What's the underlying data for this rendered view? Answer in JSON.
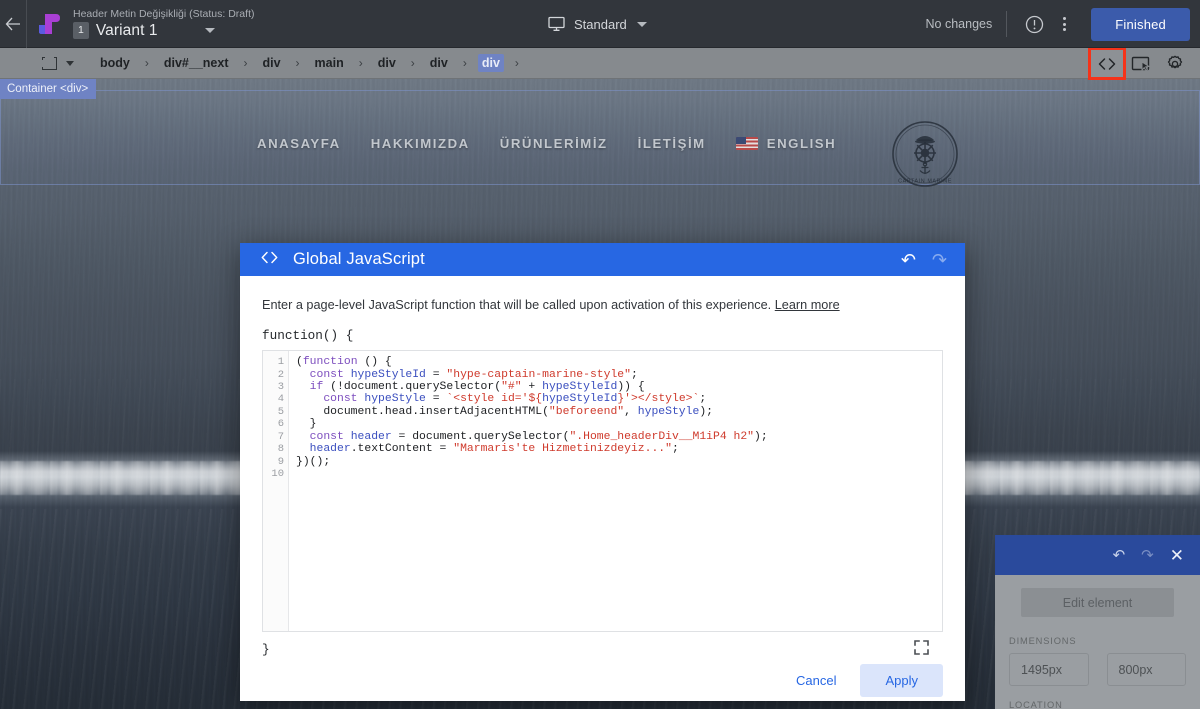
{
  "topbar": {
    "back_icon": "arrow-left-icon",
    "brand_icon": "optimizely-logo-icon",
    "experiment_name": "Header Metin Değişikliği (Status: Draft)",
    "variant_number": "1",
    "variant_label": "Variant 1",
    "device_icon": "monitor-icon",
    "device_label": "Standard",
    "changes_status": "No changes",
    "alert_icon": "exclamation-circle-icon",
    "menu_icon": "kebab-menu-icon",
    "finished_label": "Finished"
  },
  "breadcrumb": {
    "select_icon": "element-select-icon",
    "items": [
      {
        "label": "body",
        "active": false
      },
      {
        "label": "div#__next",
        "active": false
      },
      {
        "label": "div",
        "active": false
      },
      {
        "label": "main",
        "active": false
      },
      {
        "label": "div",
        "active": false
      },
      {
        "label": "div",
        "active": false
      },
      {
        "label": "div",
        "active": true
      }
    ],
    "separator": "›",
    "tools": [
      {
        "icon": "code-brackets-icon",
        "label": "<>",
        "highlighted": true,
        "highlight_color": "#f5331a"
      },
      {
        "icon": "screen-cursor-icon",
        "label": "",
        "highlighted": false
      },
      {
        "icon": "gear-icon",
        "label": "",
        "highlighted": false
      }
    ]
  },
  "canvas": {
    "selection_tooltip": "Container <div>",
    "site_nav": {
      "links": [
        "ANASAYFA",
        "HAKKIMIZDA",
        "ÜRÜNLERİMİZ",
        "İLETİŞİM"
      ],
      "language": {
        "flag_icon": "us-flag-icon",
        "label": "ENGLISH"
      },
      "logo": {
        "icon": "captain-marine-logo-icon",
        "text_top": "CAPTAIN",
        "text_bottom": "MARINE"
      }
    }
  },
  "dialog": {
    "icon": "code-brackets-icon",
    "title": "Global JavaScript",
    "undo_icon": "undo-icon",
    "redo_icon": "redo-icon",
    "description": "Enter a page-level JavaScript function that will be called upon activation of this experience.",
    "learn_more": "Learn more",
    "function_open": "function() {",
    "function_close": "}",
    "expand_icon": "fullscreen-expand-icon",
    "line_numbers": [
      "1",
      "2",
      "3",
      "4",
      "5",
      "6",
      "7",
      "8",
      "9",
      "10"
    ],
    "code_lines": [
      [
        {
          "t": "(",
          "c": "pl"
        },
        {
          "t": "function",
          "c": "kw"
        },
        {
          "t": " () {",
          "c": "pl"
        }
      ],
      [
        {
          "t": "  ",
          "c": "pl"
        },
        {
          "t": "const",
          "c": "kw"
        },
        {
          "t": " ",
          "c": "pl"
        },
        {
          "t": "hypeStyleId",
          "c": "id"
        },
        {
          "t": " = ",
          "c": "pl"
        },
        {
          "t": "\"hype-captain-marine-style\"",
          "c": "str"
        },
        {
          "t": ";",
          "c": "pl"
        }
      ],
      [
        {
          "t": "  ",
          "c": "pl"
        },
        {
          "t": "if",
          "c": "kw"
        },
        {
          "t": " (!document.querySelector(",
          "c": "pl"
        },
        {
          "t": "\"#\"",
          "c": "str"
        },
        {
          "t": " + ",
          "c": "pl"
        },
        {
          "t": "hypeStyleId",
          "c": "id"
        },
        {
          "t": ")) {",
          "c": "pl"
        }
      ],
      [
        {
          "t": "    ",
          "c": "pl"
        },
        {
          "t": "const",
          "c": "kw"
        },
        {
          "t": " ",
          "c": "pl"
        },
        {
          "t": "hypeStyle",
          "c": "id"
        },
        {
          "t": " = ",
          "c": "pl"
        },
        {
          "t": "`<style id='${",
          "c": "str"
        },
        {
          "t": "hypeStyleId",
          "c": "id"
        },
        {
          "t": "}'></style>`",
          "c": "str"
        },
        {
          "t": ";",
          "c": "pl"
        }
      ],
      [
        {
          "t": "    document.head.insertAdjacentHTML(",
          "c": "pl"
        },
        {
          "t": "\"beforeend\"",
          "c": "str"
        },
        {
          "t": ", ",
          "c": "pl"
        },
        {
          "t": "hypeStyle",
          "c": "id"
        },
        {
          "t": ");",
          "c": "pl"
        }
      ],
      [
        {
          "t": "  }",
          "c": "pl"
        }
      ],
      [
        {
          "t": "  ",
          "c": "pl"
        },
        {
          "t": "const",
          "c": "kw"
        },
        {
          "t": " ",
          "c": "pl"
        },
        {
          "t": "header",
          "c": "id"
        },
        {
          "t": " = document.querySelector(",
          "c": "pl"
        },
        {
          "t": "\".Home_headerDiv__M1iP4 h2\"",
          "c": "str"
        },
        {
          "t": ");",
          "c": "pl"
        }
      ],
      [
        {
          "t": "  ",
          "c": "pl"
        },
        {
          "t": "header",
          "c": "id"
        },
        {
          "t": ".textContent = ",
          "c": "pl"
        },
        {
          "t": "\"Marmaris'te Hizmetinizdeyiz...\"",
          "c": "str"
        },
        {
          "t": ";",
          "c": "pl"
        }
      ],
      [
        {
          "t": "})();",
          "c": "pl"
        }
      ],
      [
        {
          "t": "",
          "c": "pl"
        }
      ]
    ],
    "cancel_label": "Cancel",
    "apply_label": "Apply",
    "header_color": "#2767e3"
  },
  "side_panel": {
    "undo_icon": "undo-icon",
    "redo_icon": "redo-icon",
    "close_icon": "close-icon",
    "edit_element_label": "Edit element",
    "dimensions_label": "DIMENSIONS",
    "width_value": "1495px",
    "height_value": "800px",
    "location_label": "LOCATION",
    "header_color": "#2a4a9c"
  }
}
